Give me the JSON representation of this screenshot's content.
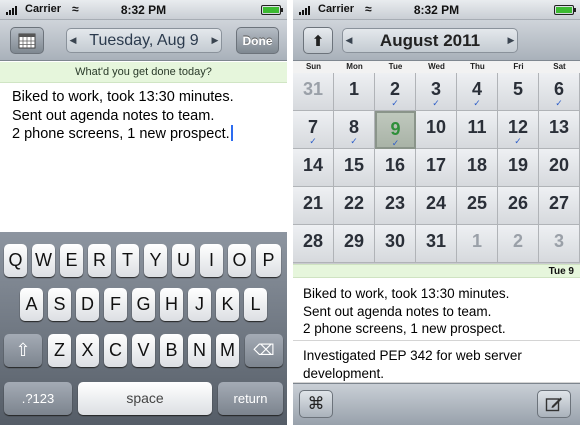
{
  "status_bar": {
    "carrier": "Carrier",
    "time": "8:32 PM",
    "wifi_icon": "wifi-icon",
    "battery_icon": "battery-icon"
  },
  "left": {
    "calendar_icon": "calendar-icon",
    "date_title": "Tuesday, Aug 9",
    "prev_icon": "chevron-left-icon",
    "next_icon": "chevron-right-icon",
    "done_label": "Done",
    "prompt": "What'd you get done today?",
    "notes": [
      "Biked to work, took 13:30 minutes.",
      "Sent out agenda notes to team.",
      "2 phone screens, 1 new prospect."
    ],
    "keyboard": {
      "row1": [
        "Q",
        "W",
        "E",
        "R",
        "T",
        "Y",
        "U",
        "I",
        "O",
        "P"
      ],
      "row2": [
        "A",
        "S",
        "D",
        "F",
        "G",
        "H",
        "J",
        "K",
        "L"
      ],
      "row3": [
        "Z",
        "X",
        "C",
        "V",
        "B",
        "N",
        "M"
      ],
      "shift_icon": "shift-icon",
      "delete_icon": "delete-icon",
      "numbers_label": ".?123",
      "space_label": "space",
      "return_label": "return"
    }
  },
  "right": {
    "up_icon": "up-arrow-icon",
    "month_title": "August 2011",
    "weekdays": [
      "Sun",
      "Mon",
      "Tue",
      "Wed",
      "Thu",
      "Fri",
      "Sat"
    ],
    "weeks": [
      [
        {
          "d": "31",
          "other": true,
          "check": false
        },
        {
          "d": "1",
          "other": false,
          "check": false
        },
        {
          "d": "2",
          "other": false,
          "check": true
        },
        {
          "d": "3",
          "other": false,
          "check": true
        },
        {
          "d": "4",
          "other": false,
          "check": true
        },
        {
          "d": "5",
          "other": false,
          "check": false
        },
        {
          "d": "6",
          "other": false,
          "check": true
        }
      ],
      [
        {
          "d": "7",
          "other": false,
          "check": true
        },
        {
          "d": "8",
          "other": false,
          "check": true
        },
        {
          "d": "9",
          "other": false,
          "check": true,
          "today": true
        },
        {
          "d": "10",
          "other": false,
          "check": false
        },
        {
          "d": "11",
          "other": false,
          "check": false
        },
        {
          "d": "12",
          "other": false,
          "check": true
        },
        {
          "d": "13",
          "other": false,
          "check": false
        }
      ],
      [
        {
          "d": "14",
          "other": false,
          "check": false
        },
        {
          "d": "15",
          "other": false,
          "check": false
        },
        {
          "d": "16",
          "other": false,
          "check": false
        },
        {
          "d": "17",
          "other": false,
          "check": false
        },
        {
          "d": "18",
          "other": false,
          "check": false
        },
        {
          "d": "19",
          "other": false,
          "check": false
        },
        {
          "d": "20",
          "other": false,
          "check": false
        }
      ],
      [
        {
          "d": "21",
          "other": false,
          "check": false
        },
        {
          "d": "22",
          "other": false,
          "check": false
        },
        {
          "d": "23",
          "other": false,
          "check": false
        },
        {
          "d": "24",
          "other": false,
          "check": false
        },
        {
          "d": "25",
          "other": false,
          "check": false
        },
        {
          "d": "26",
          "other": false,
          "check": false
        },
        {
          "d": "27",
          "other": false,
          "check": false
        }
      ],
      [
        {
          "d": "28",
          "other": false,
          "check": false
        },
        {
          "d": "29",
          "other": false,
          "check": false
        },
        {
          "d": "30",
          "other": false,
          "check": false
        },
        {
          "d": "31",
          "other": false,
          "check": false
        },
        {
          "d": "1",
          "other": true,
          "check": false
        },
        {
          "d": "2",
          "other": true,
          "check": false
        },
        {
          "d": "3",
          "other": true,
          "check": false
        }
      ]
    ],
    "selected_label": "Tue 9",
    "entry_1": [
      "Biked to work, took 13:30 minutes.",
      "Sent out agenda notes to team.",
      "2 phone screens, 1 new prospect."
    ],
    "entry_2": [
      "Investigated PEP 342 for web server",
      "development."
    ],
    "command_icon": "command-icon",
    "compose_icon": "compose-icon"
  },
  "colors": {
    "today_text": "#2f8f3a",
    "check_mark": "#2f5fc8",
    "prompt_bg": "#e6f6dc",
    "battery": "#3cba32"
  }
}
